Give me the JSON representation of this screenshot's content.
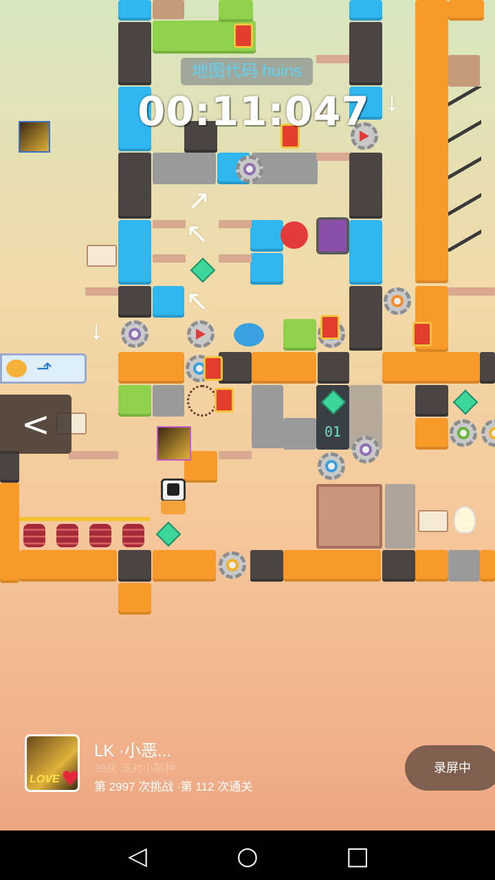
{
  "hud": {
    "map_code": "地图代码 huins",
    "timer": "00:11:047"
  },
  "player": {
    "name": "LK ·小恶...",
    "level": "39级 派对小萌种",
    "stats": "第 2997 次挑战 ·第 112 次通关",
    "avatar_text": "LOVE"
  },
  "controls": {
    "record_label": "录屏中",
    "back_glyph": "<"
  },
  "board": {
    "counter": "01"
  },
  "navbar": {
    "back": "◁",
    "home": "○",
    "recent": "□"
  },
  "colors": {
    "accent_blue": "#2fb6ee",
    "orange_block": "#f79a2a",
    "dark_block": "#4a4543",
    "green_block": "#8fd14a",
    "map_code_text": "#5fd2f4"
  }
}
